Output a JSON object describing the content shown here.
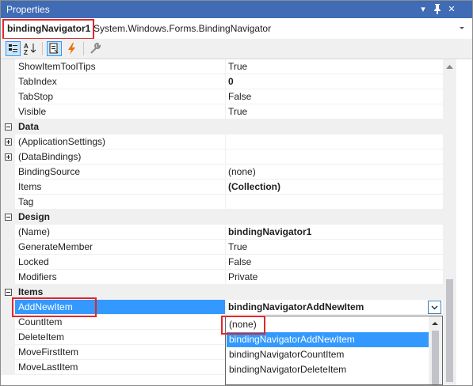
{
  "window": {
    "title": "Properties",
    "buttons": {
      "dropdown": "▾",
      "pin": "⊣",
      "close": "✕"
    }
  },
  "object_selector": {
    "name": "bindingNavigator1",
    "type": "System.Windows.Forms.BindingNavigator"
  },
  "toolbar": {
    "buttons": [
      "categorized-icon",
      "alphabetical-icon",
      "properties-icon",
      "events-icon",
      "property-pages-icon"
    ]
  },
  "grid": {
    "rows": [
      {
        "kind": "prop",
        "name": "ShowItemToolTips",
        "value": "True",
        "bold": false
      },
      {
        "kind": "prop",
        "name": "TabIndex",
        "value": "0",
        "bold": true
      },
      {
        "kind": "prop",
        "name": "TabStop",
        "value": "False",
        "bold": false
      },
      {
        "kind": "prop",
        "name": "Visible",
        "value": "True",
        "bold": false
      },
      {
        "kind": "cat",
        "name": "Data"
      },
      {
        "kind": "expand",
        "name": "(ApplicationSettings)",
        "value": ""
      },
      {
        "kind": "expand",
        "name": "(DataBindings)",
        "value": ""
      },
      {
        "kind": "prop",
        "name": "BindingSource",
        "value": "(none)",
        "bold": false
      },
      {
        "kind": "prop",
        "name": "Items",
        "value": "(Collection)",
        "bold": true
      },
      {
        "kind": "prop",
        "name": "Tag",
        "value": "",
        "bold": false
      },
      {
        "kind": "cat",
        "name": "Design"
      },
      {
        "kind": "prop",
        "name": "(Name)",
        "value": "bindingNavigator1",
        "bold": true
      },
      {
        "kind": "prop",
        "name": "GenerateMember",
        "value": "True",
        "bold": false
      },
      {
        "kind": "prop",
        "name": "Locked",
        "value": "False",
        "bold": false
      },
      {
        "kind": "prop",
        "name": "Modifiers",
        "value": "Private",
        "bold": false
      },
      {
        "kind": "cat",
        "name": "Items"
      },
      {
        "kind": "selected",
        "name": "AddNewItem",
        "value": "bindingNavigatorAddNewItem",
        "bold": true
      },
      {
        "kind": "prop",
        "name": "CountItem",
        "value": "",
        "bold": false
      },
      {
        "kind": "prop",
        "name": "DeleteItem",
        "value": "",
        "bold": false
      },
      {
        "kind": "prop",
        "name": "MoveFirstItem",
        "value": "",
        "bold": false
      },
      {
        "kind": "prop",
        "name": "MoveLastItem",
        "value": "",
        "bold": false
      }
    ]
  },
  "dropdown": {
    "options": [
      "(none)",
      "bindingNavigatorAddNewItem",
      "bindingNavigatorCountItem",
      "bindingNavigatorDeleteItem"
    ],
    "highlighted_index": 1
  },
  "colors": {
    "title_bar": "#3f6cb5",
    "selection": "#3399ff",
    "callout": "#e0262c"
  }
}
